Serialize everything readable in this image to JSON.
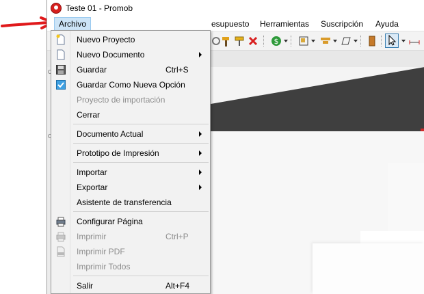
{
  "window": {
    "title": "Teste 01 - Promob"
  },
  "menubar": {
    "archivo": "Archivo",
    "presupuesto": "esupuesto",
    "herramientas": "Herramientas",
    "suscripcion": "Suscripción",
    "ayuda": "Ayuda"
  },
  "file_menu": {
    "items": [
      {
        "label": "Nuevo Proyecto",
        "shortcut": "",
        "icon": "new-project-icon",
        "enabled": true,
        "submenu": false
      },
      {
        "label": "Nuevo Documento",
        "shortcut": "",
        "icon": "new-document-icon",
        "enabled": true,
        "submenu": true
      },
      {
        "label": "Guardar",
        "shortcut": "Ctrl+S",
        "icon": "save-icon",
        "enabled": true,
        "submenu": false
      },
      {
        "label": "Guardar Como Nueva Opción",
        "shortcut": "",
        "icon": "save-as-icon",
        "enabled": true,
        "submenu": false
      },
      {
        "label": "Proyecto de importación",
        "shortcut": "",
        "icon": "",
        "enabled": false,
        "submenu": false
      },
      {
        "label": "Cerrar",
        "shortcut": "",
        "icon": "",
        "enabled": true,
        "submenu": false
      },
      {
        "label": "Documento Actual",
        "shortcut": "",
        "icon": "",
        "enabled": true,
        "submenu": true
      },
      {
        "label": "Prototipo de Impresión",
        "shortcut": "",
        "icon": "",
        "enabled": true,
        "submenu": true
      },
      {
        "label": "Importar",
        "shortcut": "",
        "icon": "",
        "enabled": true,
        "submenu": true
      },
      {
        "label": "Exportar",
        "shortcut": "",
        "icon": "",
        "enabled": true,
        "submenu": true
      },
      {
        "label": "Asistente de transferencia",
        "shortcut": "",
        "icon": "",
        "enabled": true,
        "submenu": false
      },
      {
        "label": "Configurar Página",
        "shortcut": "",
        "icon": "page-setup-icon",
        "enabled": true,
        "submenu": false
      },
      {
        "label": "Imprimir",
        "shortcut": "Ctrl+P",
        "icon": "printer-icon",
        "enabled": false,
        "submenu": false
      },
      {
        "label": "Imprimir PDF",
        "shortcut": "",
        "icon": "pdf-icon",
        "enabled": false,
        "submenu": false
      },
      {
        "label": "Imprimir Todos",
        "shortcut": "",
        "icon": "",
        "enabled": false,
        "submenu": false
      },
      {
        "label": "Salir",
        "shortcut": "Alt+F4",
        "icon": "",
        "enabled": true,
        "submenu": false
      }
    ]
  },
  "colors": {
    "menu_highlight": "#cce4f7",
    "annotation_arrow": "#e0191b",
    "app_icon": "#d6201f",
    "disabled_text": "#8d8d8d"
  }
}
